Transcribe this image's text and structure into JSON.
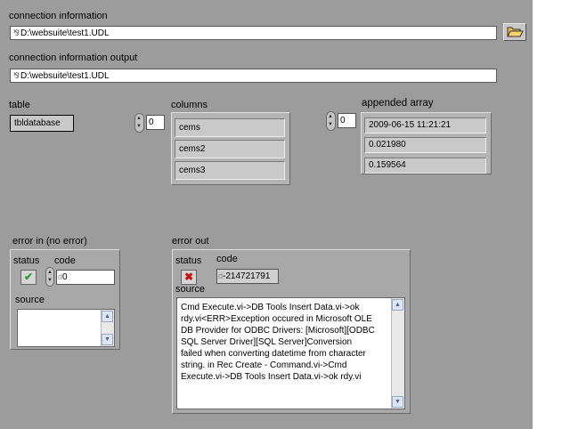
{
  "connection_info": {
    "label": "connection information",
    "path": "D:\\websuite\\test1.UDL",
    "path_icon": "path-type-icon",
    "browse_icon": "folder-open-icon"
  },
  "connection_output": {
    "label": "connection information output",
    "path": "D:\\websuite\\test1.UDL"
  },
  "table": {
    "label": "table",
    "value": "tbldatabase"
  },
  "columns": {
    "label": "columns",
    "index": "0",
    "items": [
      "cems",
      "cems2",
      "cems3"
    ]
  },
  "appended_array": {
    "label": "appended array",
    "index": "0",
    "items": [
      "2009-06-15 11:21:21",
      "0.021980",
      "0.159564"
    ]
  },
  "error_in": {
    "label": "error in (no error)",
    "status_label": "status",
    "code_label": "code",
    "code_radix": "d",
    "code": "0",
    "source_label": "source",
    "source": "",
    "status_icon": "checkmark-icon",
    "status_color": "#2e9e2e"
  },
  "error_out": {
    "label": "error out",
    "status_label": "status",
    "code_label": "code",
    "code_radix": "d",
    "code": "-214721791",
    "source_label": "source",
    "status_icon": "x-mark-icon",
    "status_color": "#cc1111",
    "source": "Cmd Execute.vi->DB Tools Insert Data.vi->ok\nrdy.vi<ERR>Exception occured in Microsoft OLE\nDB Provider for ODBC Drivers: [Microsoft][ODBC\nSQL Server Driver][SQL Server]Conversion\nfailed when converting datetime from character\nstring. in Rec Create - Command.vi->Cmd\nExecute.vi->DB Tools Insert Data.vi->ok rdy.vi"
  }
}
